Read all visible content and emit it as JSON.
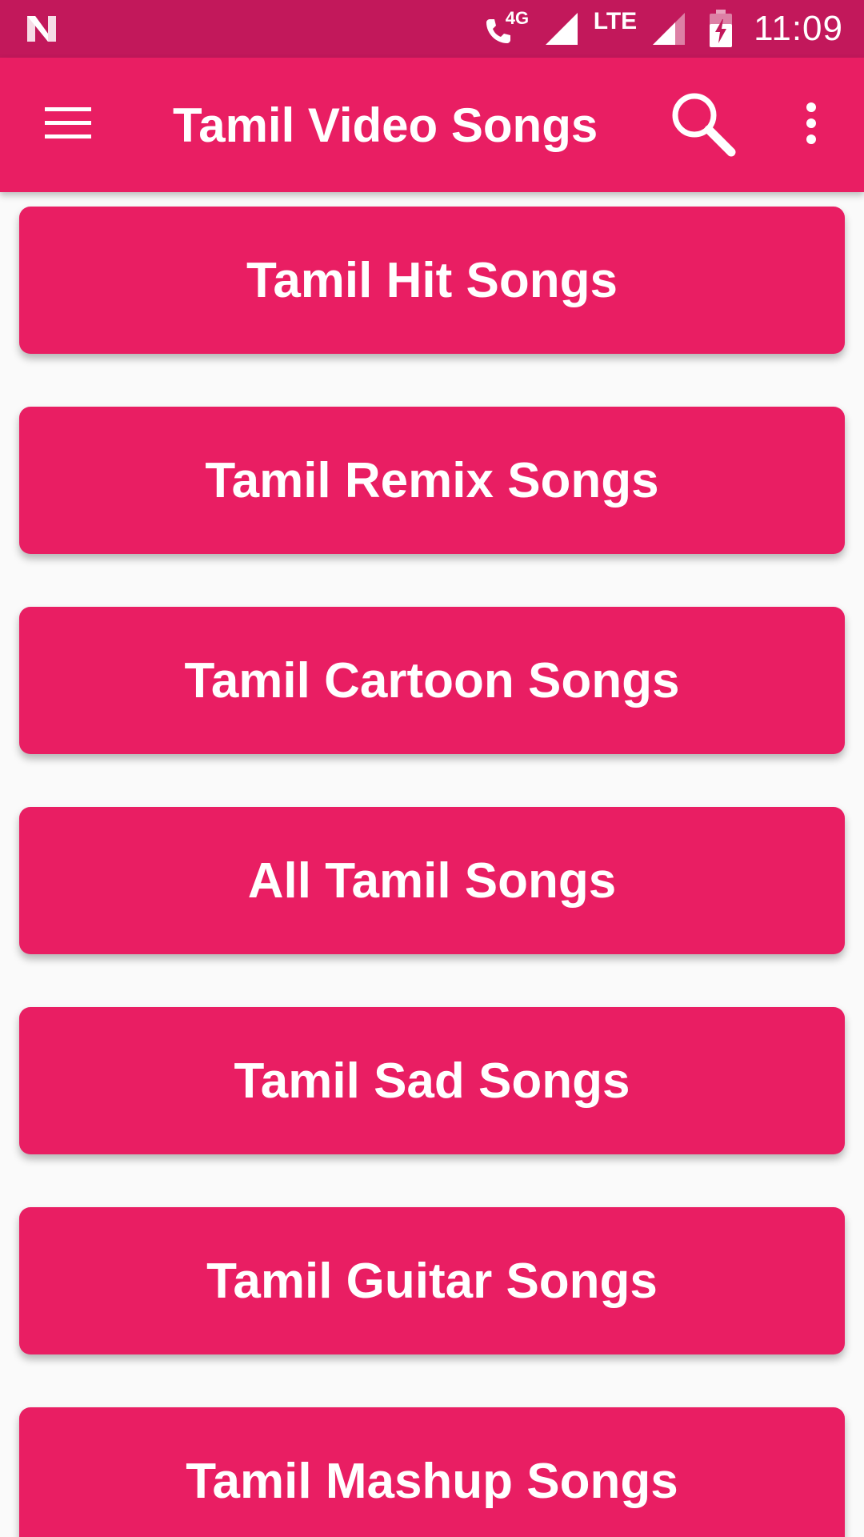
{
  "status_bar": {
    "network_badge": "4G",
    "carrier_type": "LTE",
    "time": "11:09",
    "icons": [
      "n-logo-icon",
      "wifi-call-icon",
      "signal-icon",
      "signal-partial-icon",
      "battery-charging-icon"
    ]
  },
  "app_bar": {
    "title": "Tamil Video Songs",
    "icons": [
      "hamburger-menu-icon",
      "search-icon",
      "more-vert-icon"
    ]
  },
  "categories": [
    {
      "label": "Tamil Hit Songs"
    },
    {
      "label": "Tamil Remix Songs"
    },
    {
      "label": "Tamil Cartoon Songs"
    },
    {
      "label": "All Tamil Songs"
    },
    {
      "label": "Tamil Sad Songs"
    },
    {
      "label": "Tamil Guitar Songs"
    },
    {
      "label": "Tamil Mashup Songs"
    }
  ],
  "colors": {
    "status_bar": "#c2185b",
    "primary": "#e91e63",
    "background": "#fafafa",
    "text": "#ffffff"
  }
}
